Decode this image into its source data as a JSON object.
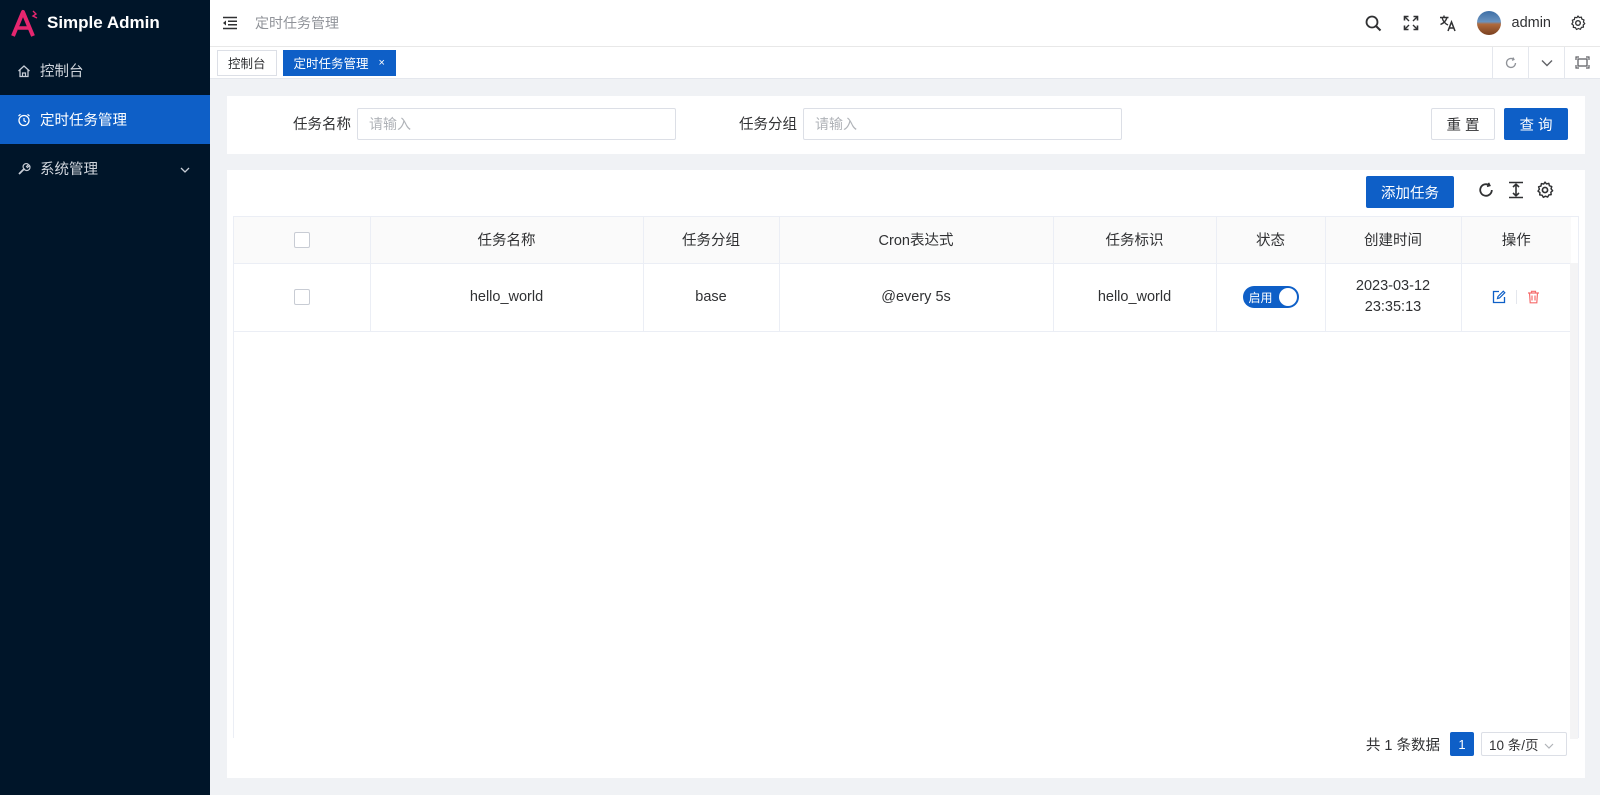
{
  "app": {
    "title": "Simple Admin"
  },
  "colors": {
    "primary": "#0e5fc7",
    "sidebar_bg": "#001529",
    "logo_accent": "#e6266f",
    "danger": "#f56c6c"
  },
  "sidebar": {
    "items": [
      {
        "label": "控制台",
        "icon": "home-icon"
      },
      {
        "label": "定时任务管理",
        "icon": "alarm-clock-icon",
        "active": true
      },
      {
        "label": "系统管理",
        "icon": "wrench-icon",
        "expandable": true
      }
    ]
  },
  "header": {
    "breadcrumb": "定时任务管理",
    "username": "admin",
    "icons": [
      "menu-fold-icon",
      "search-icon",
      "fullscreen-icon",
      "translate-icon",
      "settings-icon"
    ]
  },
  "tabs": {
    "items": [
      {
        "label": "控制台",
        "active": false
      },
      {
        "label": "定时任务管理",
        "active": true,
        "close": "×"
      }
    ],
    "actions": [
      "refresh-icon",
      "chevron-down-icon",
      "maximize-icon"
    ]
  },
  "search": {
    "fields": [
      {
        "label": "任务名称",
        "placeholder": "请输入",
        "value": ""
      },
      {
        "label": "任务分组",
        "placeholder": "请输入",
        "value": ""
      }
    ],
    "reset_label": "重 置",
    "query_label": "查 询"
  },
  "table": {
    "add_label": "添加任务",
    "toolbar_icons": [
      "refresh-icon",
      "column-height-icon",
      "settings-icon"
    ],
    "columns": [
      "任务名称",
      "任务分组",
      "Cron表达式",
      "任务标识",
      "状态",
      "创建时间",
      "操作"
    ],
    "rows": [
      {
        "name": "hello_world",
        "group": "base",
        "cron": "@every 5s",
        "key": "hello_world",
        "status_label": "启用",
        "status_on": true,
        "created_date": "2023-03-12",
        "created_time": "23:35:13"
      }
    ]
  },
  "pagination": {
    "total_text": "共 1 条数据",
    "current_page": "1",
    "page_size": "10 条/页"
  }
}
